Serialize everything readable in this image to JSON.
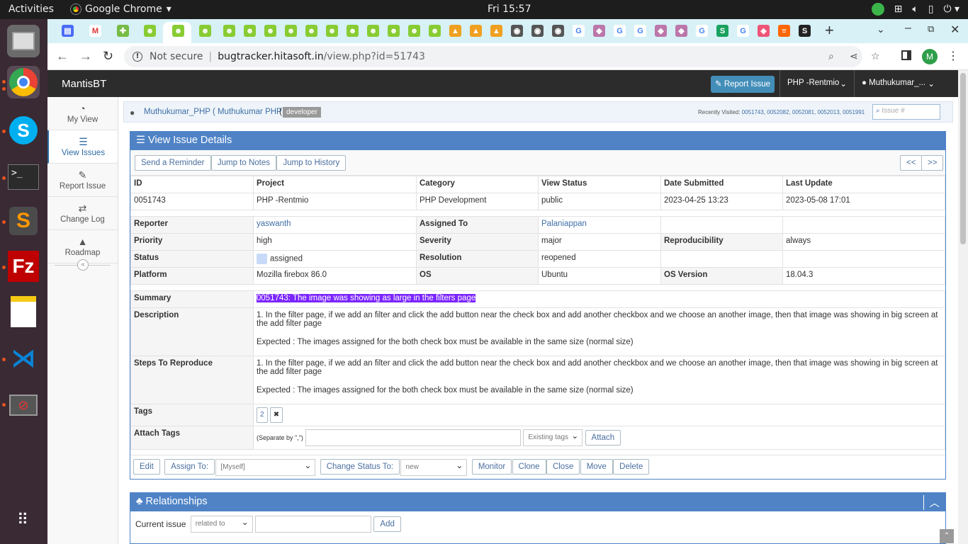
{
  "os": {
    "activities": "Activities",
    "app_name": "Google Chrome",
    "clock": "Fri 15:57"
  },
  "browser": {
    "security": "Not secure",
    "url_domain": "bugtracker.hitasoft.in",
    "url_path": "/view.php?id=51743",
    "profile_initial": "M"
  },
  "app": {
    "brand": "MantisBT",
    "report_btn": "Report Issue",
    "project_menu": "PHP -Rentmio",
    "user_menu": "Muthukumar_..."
  },
  "sidebar": [
    {
      "label": "My View",
      "icon": "dashboard-icon"
    },
    {
      "label": "View Issues",
      "icon": "list-icon"
    },
    {
      "label": "Report Issue",
      "icon": "edit-icon"
    },
    {
      "label": "Change Log",
      "icon": "retweet-icon"
    },
    {
      "label": "Roadmap",
      "icon": "road-icon"
    }
  ],
  "userbar": {
    "user": "Muthukumar_PHP ( Muthukumar PHP )",
    "paren": "(",
    "role": "developer",
    "recent_label": "Recently Visited:",
    "recent": [
      "0051743",
      "0052082",
      "0052081",
      "0052013",
      "0051991"
    ],
    "search_placeholder": "Issue #"
  },
  "panel": {
    "title": "View Issue Details",
    "reminder": "Send a Reminder",
    "jump_notes": "Jump to Notes",
    "jump_history": "Jump to History",
    "prev": "<<",
    "next": ">>"
  },
  "header_cols": [
    "ID",
    "Project",
    "Category",
    "View Status",
    "Date Submitted",
    "Last Update"
  ],
  "header_vals": [
    "0051743",
    "PHP -Rentmio",
    "PHP Development",
    "public",
    "2023-04-25 13:23",
    "2023-05-08 17:01"
  ],
  "fields": {
    "reporter_l": "Reporter",
    "reporter": "yaswanth",
    "assigned_l": "Assigned To",
    "assigned": "Palaniappan",
    "priority_l": "Priority",
    "priority": "high",
    "severity_l": "Severity",
    "severity": "major",
    "repro_l": "Reproducibility",
    "repro": "always",
    "status_l": "Status",
    "status": "assigned",
    "resolution_l": "Resolution",
    "resolution": "reopened",
    "platform_l": "Platform",
    "platform": "Mozilla firebox 86.0",
    "os_l": "OS",
    "os": "Ubuntu",
    "osver_l": "OS Version",
    "osver": "18.04.3"
  },
  "summary_l": "Summary",
  "summary": "0051743: The image was showing as large in the filters page",
  "description_l": "Description",
  "description_1": "1. In the filter page, if we add an filter and click the add button near the check box and add another checkbox and we choose an another image, then that image was showing in big screen at the add filter page",
  "description_2": "Expected : The images assigned for the both check box must be available in the same size (normal size)",
  "steps_l": "Steps To Reproduce",
  "steps_1": "1. In the filter page, if we add an filter and click the add button near the check box and add another checkbox and we choose an another image, then that image was showing in big screen at the add filter page",
  "steps_2": "Expected : The images assigned for the both check box must be available in the same size (normal size)",
  "tags_l": "Tags",
  "tag": "2",
  "tag_remove": "✖",
  "attach_l": "Attach Tags",
  "attach_hint": "(Separate by \",\")",
  "existing_tags": "Existing tags",
  "attach_btn": "Attach",
  "actions": {
    "edit": "Edit",
    "assign_to": "Assign To:",
    "assign_val": "[Myself]",
    "change_status": "Change Status To:",
    "status_val": "new",
    "monitor": "Monitor",
    "clone": "Clone",
    "close": "Close",
    "move": "Move",
    "delete": "Delete"
  },
  "relationships": {
    "title": "Relationships",
    "current": "Current issue",
    "rel_type": "related to",
    "add": "Add"
  },
  "colors": {
    "accent": "#438eb9",
    "panel_header": "#4f83c6",
    "navbar": "#2c2c2c",
    "highlight": "#7b25ff"
  }
}
